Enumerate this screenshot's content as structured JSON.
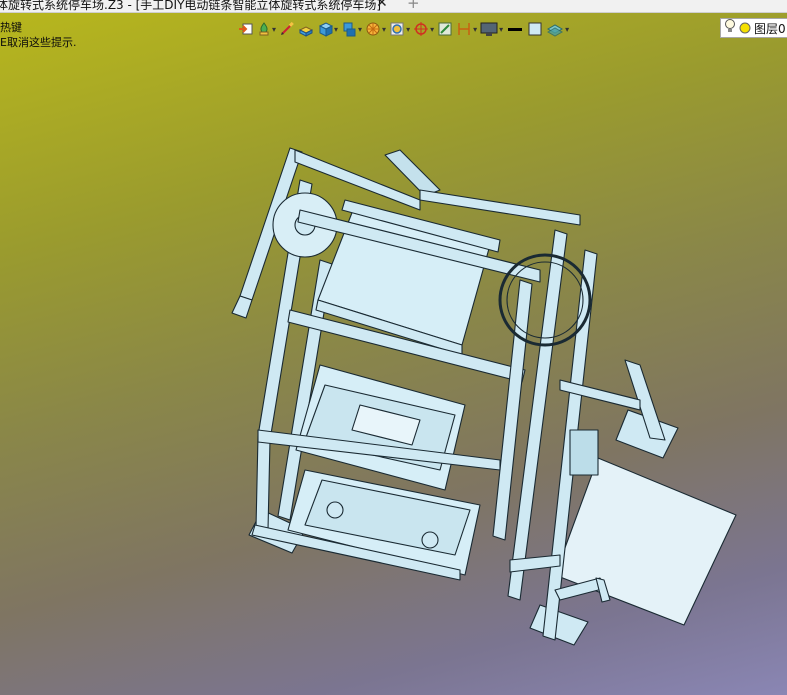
{
  "window": {
    "title": "体旋转式系统停车场.Z3 - [手工DIY电动链条智能立体旋转式系统停车场]",
    "close_glyph": "✕",
    "add_glyph": "+"
  },
  "hint": {
    "line1": "热键",
    "line2": "E取消这些提示."
  },
  "toolbar": {
    "icons": [
      "insert-icon",
      "paint-icon",
      "sketch-icon",
      "extrude-icon",
      "cube-icon",
      "shape-icon",
      "section-icon",
      "analysis-icon",
      "snap-icon",
      "datum-icon",
      "measure-icon",
      "display-icon",
      "line-style-icon",
      "color-swatch-icon",
      "layer-stack-icon"
    ]
  },
  "layer": {
    "label": "图层0",
    "bulb_icon": "lightbulb-icon",
    "color": "#f5e000"
  },
  "colors": {
    "model_fill": "#cfe9f3",
    "model_edge": "#1a2a33"
  }
}
